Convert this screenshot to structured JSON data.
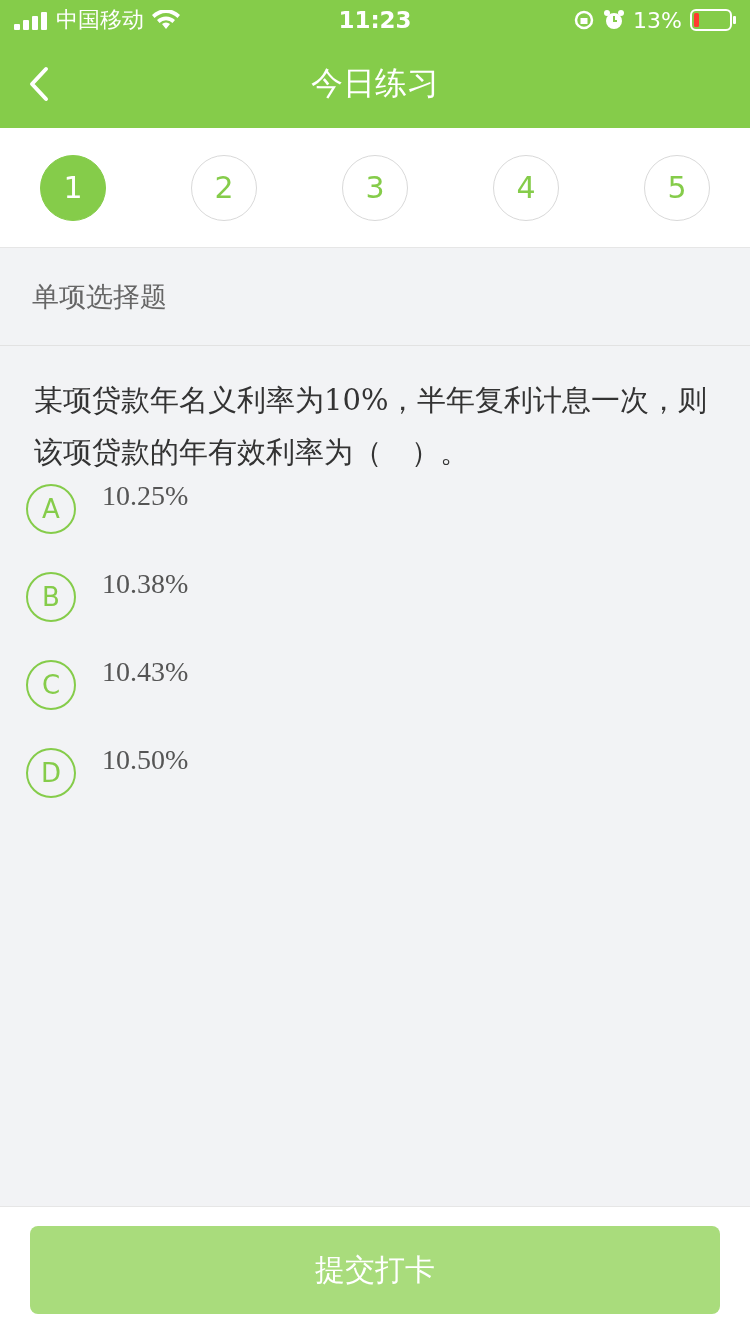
{
  "status_bar": {
    "carrier": "中国移动",
    "time": "11:23",
    "battery_percent": "13%"
  },
  "nav": {
    "title": "今日练习"
  },
  "steps": [
    {
      "label": "1",
      "selected": true
    },
    {
      "label": "2",
      "selected": false
    },
    {
      "label": "3",
      "selected": false
    },
    {
      "label": "4",
      "selected": false
    },
    {
      "label": "5",
      "selected": false
    }
  ],
  "section": {
    "title": "单项选择题"
  },
  "question": {
    "text": "某项贷款年名义利率为10%，半年复利计息一次，则该项贷款的年有效利率为（　）。"
  },
  "options": [
    {
      "letter": "A",
      "text": "10.25%",
      "selected": false
    },
    {
      "letter": "B",
      "text": "10.38%",
      "selected": false
    },
    {
      "letter": "C",
      "text": "10.43%",
      "selected": false
    },
    {
      "letter": "D",
      "text": "10.50%",
      "selected": false
    }
  ],
  "submit": {
    "label": "提交打卡",
    "disabled": true
  }
}
